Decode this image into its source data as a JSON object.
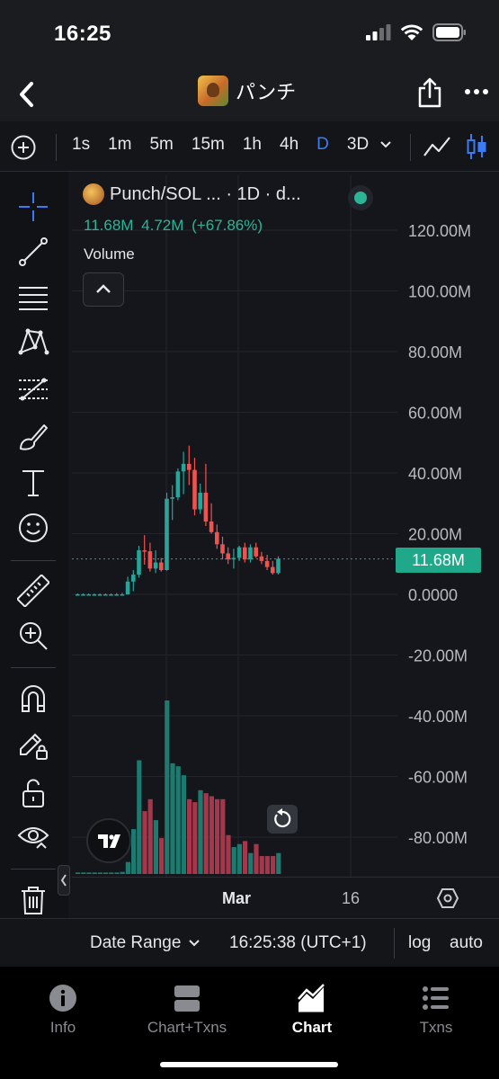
{
  "status_bar": {
    "time": "16:25"
  },
  "nav": {
    "title": "パンチ"
  },
  "toolbar": {
    "timeframes": [
      {
        "label": "1s",
        "active": false
      },
      {
        "label": "1m",
        "active": false
      },
      {
        "label": "5m",
        "active": false
      },
      {
        "label": "15m",
        "active": false
      },
      {
        "label": "1h",
        "active": false
      },
      {
        "label": "4h",
        "active": false
      },
      {
        "label": "D",
        "active": true
      },
      {
        "label": "3D",
        "active": false
      }
    ]
  },
  "legend": {
    "title": "Punch/SOL ... · 1D · d...",
    "values": "11.68M 4.72M (+67.86%)",
    "volume_label": "Volume"
  },
  "price_tag": "11.68M",
  "chart_data": {
    "type": "candlestick",
    "y_axis_labels": [
      "120.00M",
      "100.00M",
      "80.00M",
      "60.00M",
      "40.00M",
      "20.00M",
      "0.0000",
      "-20.00M",
      "-40.00M",
      "-60.00M",
      "-80.00M"
    ],
    "ylim": [
      -92000000,
      128000000
    ],
    "x_ticks": [
      "Mar",
      "16"
    ],
    "last_price": 11680000,
    "colors": {
      "up": "#26a69a",
      "down": "#ef5350",
      "up_volume": "#1e7a6e",
      "down_volume": "#a8364a"
    },
    "candles": [
      {
        "o": 0,
        "h": 0.3,
        "l": -0.3,
        "c": 0,
        "v": 0.5
      },
      {
        "o": 0,
        "h": 0.3,
        "l": -0.3,
        "c": 0,
        "v": 0.5
      },
      {
        "o": 0,
        "h": 0.3,
        "l": -0.3,
        "c": 0,
        "v": 0.5
      },
      {
        "o": 0,
        "h": 0.3,
        "l": -0.3,
        "c": 0,
        "v": 0.5
      },
      {
        "o": 0,
        "h": 0.3,
        "l": -0.3,
        "c": 0,
        "v": 0.5
      },
      {
        "o": 0,
        "h": 0.3,
        "l": -0.3,
        "c": 0,
        "v": 0.5
      },
      {
        "o": 0,
        "h": 0.3,
        "l": -0.3,
        "c": 0,
        "v": 0.5
      },
      {
        "o": 0,
        "h": 0.4,
        "l": -0.3,
        "c": 0,
        "v": 0.5
      },
      {
        "o": 0,
        "h": 0.5,
        "l": -0.2,
        "c": 0,
        "v": 0.7
      },
      {
        "o": 0,
        "h": 5.8,
        "l": -0.1,
        "c": 4.2,
        "v": 4
      },
      {
        "o": 4.2,
        "h": 8.0,
        "l": 1.0,
        "c": 6.5,
        "v": 15
      },
      {
        "o": 6.5,
        "h": 16.0,
        "l": 5.5,
        "c": 14.5,
        "v": 38
      },
      {
        "o": 14.5,
        "h": 19.5,
        "l": 9.8,
        "c": 14.2,
        "v": 21
      },
      {
        "o": 14.2,
        "h": 17.0,
        "l": 7.5,
        "c": 8.5,
        "v": 25
      },
      {
        "o": 8.5,
        "h": 14.5,
        "l": 7.0,
        "c": 10.5,
        "v": 18
      },
      {
        "o": 10.5,
        "h": 12.0,
        "l": 7.5,
        "c": 8.0,
        "v": 12
      },
      {
        "o": 8.0,
        "h": 33.5,
        "l": 7.8,
        "c": 31.5,
        "v": 58
      },
      {
        "o": 31.5,
        "h": 36.0,
        "l": 24.5,
        "c": 32.0,
        "v": 37
      },
      {
        "o": 32.0,
        "h": 41.5,
        "l": 31.0,
        "c": 40.5,
        "v": 36
      },
      {
        "o": 40.5,
        "h": 47.0,
        "l": 33.0,
        "c": 43.0,
        "v": 33
      },
      {
        "o": 43.0,
        "h": 49.0,
        "l": 36.0,
        "c": 41.0,
        "v": 25
      },
      {
        "o": 41.0,
        "h": 45.0,
        "l": 26.0,
        "c": 28.0,
        "v": 24
      },
      {
        "o": 28.0,
        "h": 36.5,
        "l": 26.5,
        "c": 33.5,
        "v": 28
      },
      {
        "o": 33.5,
        "h": 43.0,
        "l": 22.5,
        "c": 24.0,
        "v": 27
      },
      {
        "o": 24.0,
        "h": 30.0,
        "l": 20.0,
        "c": 20.5,
        "v": 26
      },
      {
        "o": 20.5,
        "h": 23.0,
        "l": 15.0,
        "c": 16.5,
        "v": 25
      },
      {
        "o": 16.5,
        "h": 19.0,
        "l": 11.5,
        "c": 13.5,
        "v": 25
      },
      {
        "o": 13.5,
        "h": 15.5,
        "l": 10.0,
        "c": 11.5,
        "v": 13
      },
      {
        "o": 11.5,
        "h": 15.0,
        "l": 8.5,
        "c": 12.0,
        "v": 9
      },
      {
        "o": 12.0,
        "h": 16.0,
        "l": 11.0,
        "c": 15.5,
        "v": 10
      },
      {
        "o": 15.5,
        "h": 17.0,
        "l": 10.5,
        "c": 11.5,
        "v": 11
      },
      {
        "o": 11.5,
        "h": 16.5,
        "l": 10.5,
        "c": 15.5,
        "v": 7
      },
      {
        "o": 15.5,
        "h": 17.0,
        "l": 12.0,
        "c": 12.5,
        "v": 10
      },
      {
        "o": 12.5,
        "h": 14.0,
        "l": 10.0,
        "c": 11.0,
        "v": 6
      },
      {
        "o": 11.0,
        "h": 13.0,
        "l": 8.0,
        "c": 9.0,
        "v": 6
      },
      {
        "o": 9.0,
        "h": 11.0,
        "l": 6.5,
        "c": 7.0,
        "v": 6
      },
      {
        "o": 7.0,
        "h": 12.5,
        "l": 6.5,
        "c": 11.7,
        "v": 7
      }
    ]
  },
  "time_axis": {
    "tick_mar": "Mar",
    "tick_16": "16"
  },
  "bottom_bar": {
    "date_range": "Date Range",
    "clock": "16:25:38 (UTC+1)",
    "log": "log",
    "auto": "auto"
  },
  "tabs": [
    {
      "label": "Info",
      "active": false
    },
    {
      "label": "Chart+Txns",
      "active": false
    },
    {
      "label": "Chart",
      "active": true
    },
    {
      "label": "Txns",
      "active": false
    }
  ]
}
